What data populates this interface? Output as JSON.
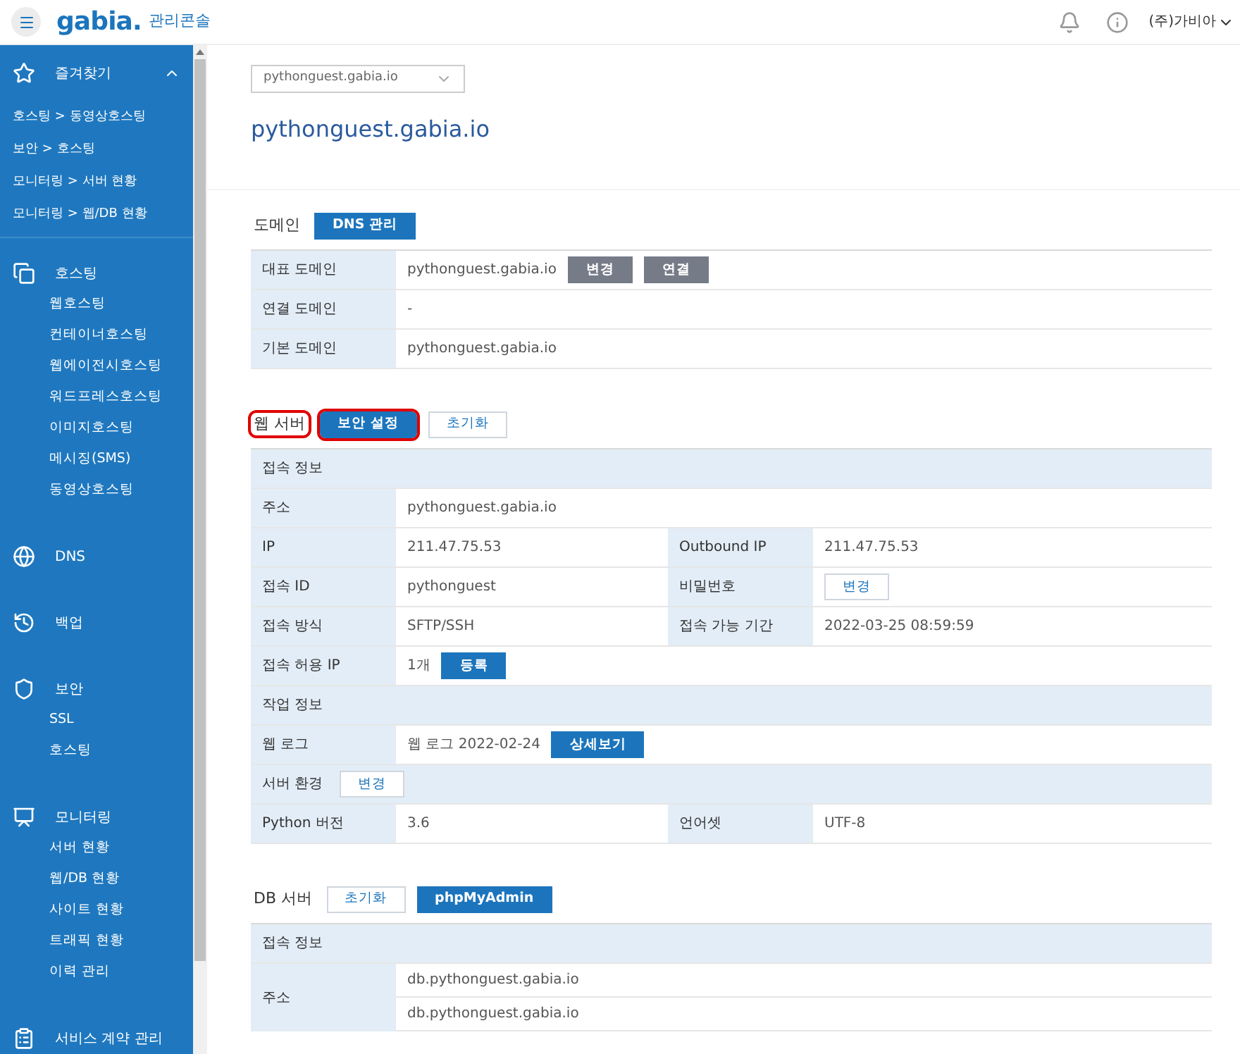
{
  "header": {
    "logo": "gabia.",
    "title": "관리콘솔",
    "account": "(주)가비아"
  },
  "sidebar": {
    "favorites": {
      "label": "즐겨찾기",
      "expanded": true,
      "links": [
        "호스팅 > 동영상호스팅",
        "보안 > 호스팅",
        "모니터링 > 서버 현황",
        "모니터링 > 웹/DB 현황"
      ]
    },
    "groups": [
      {
        "label": "호스팅",
        "kind": "hosting",
        "items": [
          "웹호스팅",
          "컨테이너호스팅",
          "웹에이전시호스팅",
          "워드프레스호스팅",
          "이미지호스팅",
          "메시징(SMS)",
          "동영상호스팅"
        ]
      },
      {
        "label": "DNS",
        "kind": "dns"
      },
      {
        "label": "백업",
        "kind": "backup"
      },
      {
        "label": "보안",
        "kind": "security",
        "items": [
          "SSL",
          "호스팅"
        ]
      },
      {
        "label": "모니터링",
        "kind": "monitoring",
        "items": [
          "서버 현황",
          "웹/DB 현황",
          "사이트 현황",
          "트래픽 현황",
          "이력 관리"
        ]
      },
      {
        "label": "서비스 계약 관리",
        "kind": "contract"
      }
    ]
  },
  "domain_select": {
    "value": "pythonguest.gabia.io"
  },
  "site_title": "pythonguest.gabia.io",
  "sections": [
    {
      "title": "도메인",
      "highlighted": false,
      "buttons": [
        {
          "label": "DNS 관리",
          "kind": "primary",
          "highlighted": false
        }
      ],
      "rows": [
        {
          "kind": "single",
          "label": "대표 도메인",
          "value": "pythonguest.gabia.io",
          "buttons": [
            {
              "label": "변경",
              "kind": "gray"
            },
            {
              "label": "연결",
              "kind": "gray"
            }
          ]
        },
        {
          "kind": "single",
          "label": "연결 도메인",
          "value": "-"
        },
        {
          "kind": "single",
          "label": "기본 도메인",
          "value": "pythonguest.gabia.io"
        }
      ]
    },
    {
      "title": "웹 서버",
      "highlighted": true,
      "buttons": [
        {
          "label": "보안 설정",
          "kind": "primary",
          "highlighted": true
        },
        {
          "label": "초기화",
          "kind": "outline",
          "highlighted": false
        }
      ],
      "rows": [
        {
          "kind": "header",
          "label": "접속 정보"
        },
        {
          "kind": "single",
          "label": "주소",
          "value": "pythonguest.gabia.io"
        },
        {
          "kind": "pair",
          "label": "IP",
          "value": "211.47.75.53",
          "label_2": "Outbound IP",
          "value_2": "211.47.75.53"
        },
        {
          "kind": "pair",
          "label": "접속 ID",
          "value": "pythonguest",
          "label_2": "비밀번호",
          "buttons_2": [
            {
              "label": "변경",
              "kind": "outline"
            }
          ]
        },
        {
          "kind": "pair",
          "label": "접속 방식",
          "value": "SFTP/SSH",
          "label_2": "접속 가능 기간",
          "value_2": "2022-03-25 08:59:59"
        },
        {
          "kind": "single",
          "label": "접속 허용 IP",
          "value": "1개",
          "buttons": [
            {
              "label": "등록",
              "kind": "primary"
            }
          ]
        },
        {
          "kind": "header",
          "label": "작업 정보"
        },
        {
          "kind": "single",
          "label": "웹 로그",
          "value": "웹 로그 2022-02-24",
          "buttons": [
            {
              "label": "상세보기",
              "kind": "primary"
            }
          ]
        },
        {
          "kind": "header",
          "label": "서버 환경",
          "buttons": [
            {
              "label": "변경",
              "kind": "outline"
            }
          ]
        },
        {
          "kind": "pair",
          "label": "Python 버전",
          "value": "3.6",
          "label_2": "언어셋",
          "value_2": "UTF-8"
        }
      ]
    },
    {
      "title": "DB 서버",
      "highlighted": false,
      "buttons": [
        {
          "label": "초기화",
          "kind": "outline",
          "highlighted": false
        },
        {
          "label": "phpMyAdmin",
          "kind": "primary",
          "highlighted": false
        }
      ],
      "rows": [
        {
          "kind": "header",
          "label": "접속 정보"
        },
        {
          "kind": "multi",
          "label": "주소",
          "values": [
            "db.pythonguest.gabia.io",
            "db.pythonguest.gabia.io"
          ]
        }
      ]
    }
  ]
}
